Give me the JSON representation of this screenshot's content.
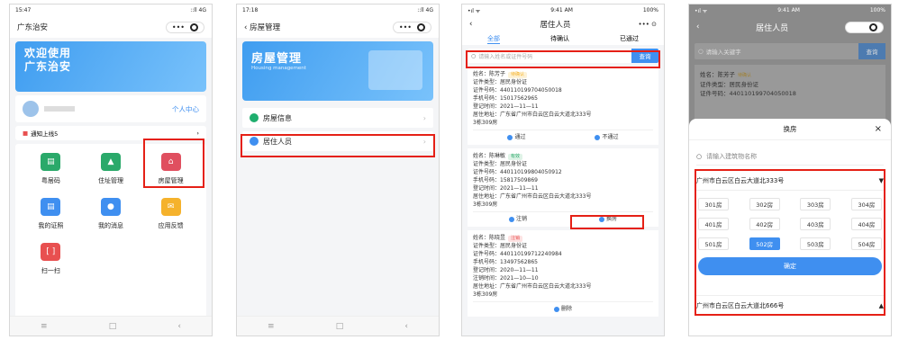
{
  "p1": {
    "time": "15:47",
    "signal": "::ll 4G",
    "title": "广东治安",
    "banner_l1": "欢迎使用",
    "banner_l2": "广东治安",
    "user_center": "个人中心",
    "notice": "通知上线5",
    "grid": [
      {
        "label": "粤居码",
        "color": "#2aa96a"
      },
      {
        "label": "住址管理",
        "color": "#2aa96a"
      },
      {
        "label": "房屋管理",
        "color": "#e04f5f"
      },
      {
        "label": "我的证照",
        "color": "#3f8ff0"
      },
      {
        "label": "我的消息",
        "color": "#3f8ff0"
      },
      {
        "label": "应用反馈",
        "color": "#f5b22c"
      },
      {
        "label": "扫一扫",
        "color": "#e85050"
      }
    ]
  },
  "p2": {
    "time": "17:18",
    "signal": "::ll 4G",
    "title": "房屋管理",
    "banner_title": "房屋管理",
    "banner_sub": "Housing management",
    "rows": [
      "房屋信息",
      "居住人员"
    ]
  },
  "p3": {
    "time": "9:41 AM",
    "battery": "100%",
    "title": "居住人员",
    "tabs": [
      "全部",
      "待确认",
      "已通过"
    ],
    "search_placeholder": "请输入姓名或证件号码",
    "search_btn": "查询",
    "cards": [
      {
        "name": "姓名：陈芳子",
        "tag": "待确认",
        "tag_color": "#f5b22c",
        "lines": [
          "证件类型：居民身份证",
          "证件号码：440110199704050018",
          "手机号码：15017562965",
          "登记时间：2021—11—11",
          "居住地址：广东省广州市白云区白云大道北333号",
          "3栋309房"
        ],
        "acts": [
          "通过",
          "不通过"
        ]
      },
      {
        "name": "姓名：陈琳敏",
        "tag": "有效",
        "tag_color": "#2aa96a",
        "lines": [
          "证件类型：居民身份证",
          "证件号码：440110199804050912",
          "手机号码：15817509869",
          "登记时间：2021—11—11",
          "居住地址：广东省广州市白云区白云大道北333号",
          "3栋309房"
        ],
        "acts": [
          "注销",
          "换房"
        ]
      },
      {
        "name": "姓名：陈晓昱",
        "tag": "注销",
        "tag_color": "#e85050",
        "lines": [
          "证件类型：居民身份证",
          "证件号码：440110199712240984",
          "手机号码：13497562865",
          "登记时间：2020—11—11",
          "注销时间：2021—10—10",
          "居住地址：广东省广州市白云区白云大道北333号",
          "3栋309房"
        ],
        "acts": [
          "删除"
        ]
      }
    ]
  },
  "p4": {
    "time": "9:41 AM",
    "battery": "100%",
    "title": "居住人员",
    "search_placeholder": "请输入关键字",
    "search_btn": "查询",
    "bg_lines": [
      "姓名：陈芳子",
      "证件类型：居民身份证",
      "证件号码：440110199704050018"
    ],
    "bg_tag": "待确认",
    "sheet_title": "换房",
    "close": "×",
    "building_placeholder": "请输入建筑物名称",
    "addr1": "广州市白云区白云大道北333号",
    "rooms": [
      "301房",
      "302房",
      "303房",
      "304房",
      "401房",
      "402房",
      "403房",
      "404房",
      "501房",
      "502房",
      "503房",
      "504房"
    ],
    "selected": "502房",
    "confirm": "确定",
    "addr2": "广州市白云区白云大道北666号"
  }
}
